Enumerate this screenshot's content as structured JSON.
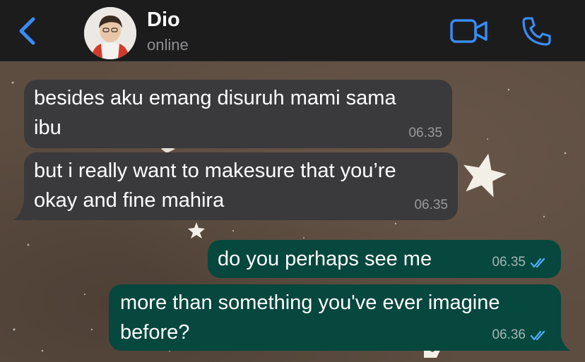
{
  "header": {
    "contact_name": "Dio",
    "contact_status": "online",
    "accent_color": "#3a8cf5",
    "icons": [
      "chevron-left-icon",
      "video-call-icon",
      "phone-call-icon"
    ]
  },
  "messages": [
    {
      "direction": "incoming",
      "line1": "besides aku emang disuruh mami sama",
      "line2": "ibu",
      "time": "06.35"
    },
    {
      "direction": "incoming",
      "line1": "but i really want to makesure that you’re",
      "line2": "okay and fine mahira",
      "time": "06.35"
    },
    {
      "direction": "outgoing",
      "line1": "do you perhaps see me",
      "time": "06.35",
      "read": true
    },
    {
      "direction": "outgoing",
      "line1": "more than something you've ever imagine",
      "line2": "before?",
      "time": "06.36",
      "read": true
    }
  ]
}
